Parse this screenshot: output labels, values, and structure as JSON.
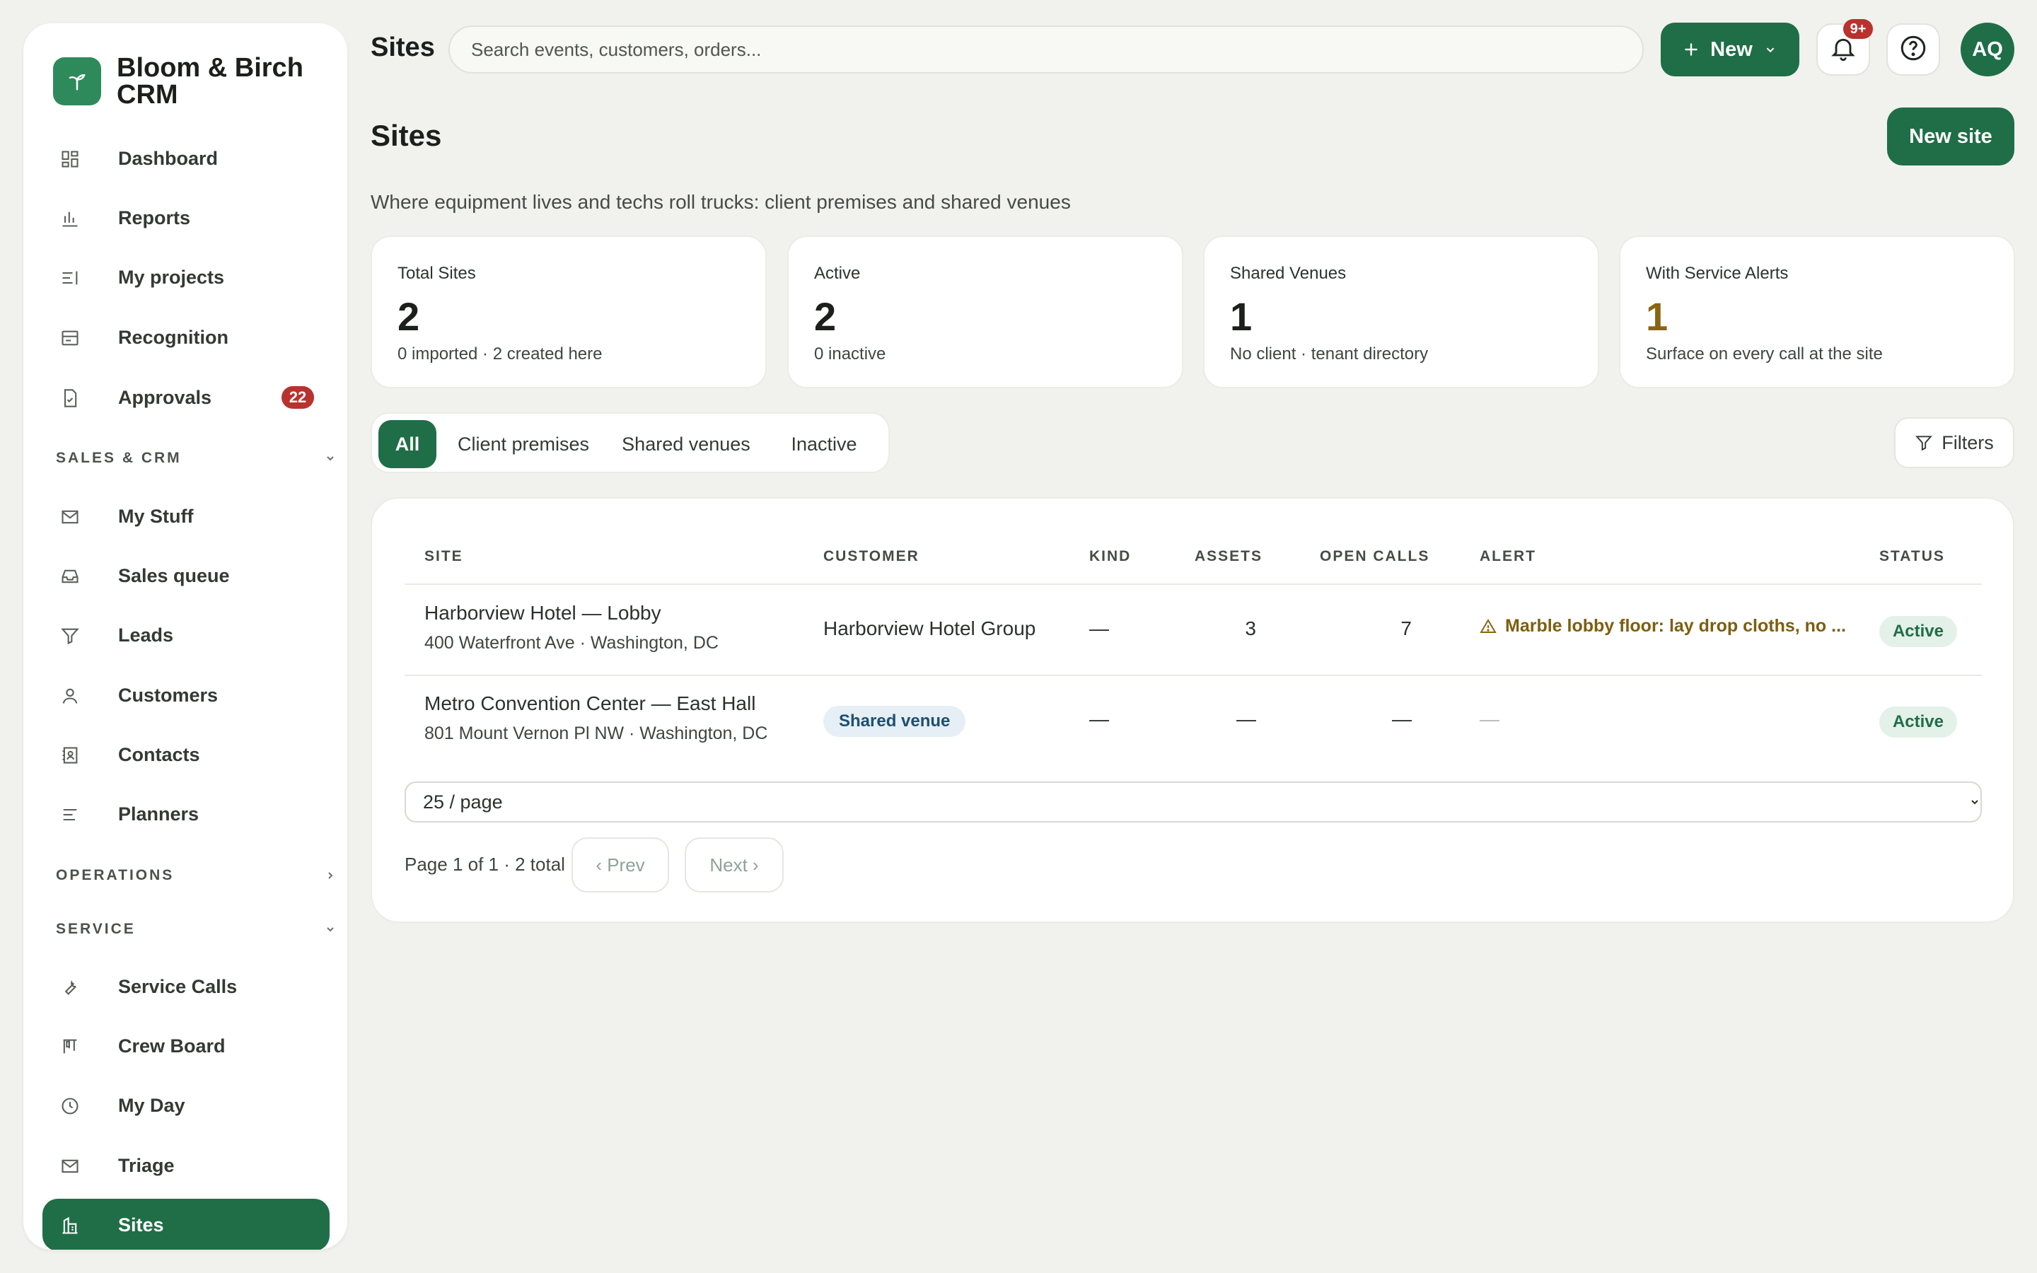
{
  "brand": {
    "name": "Bloom & Birch CRM",
    "logo_icon": "wand-icon",
    "color": "#2f8a5b"
  },
  "sidebar": {
    "items_top": [
      {
        "label": "Dashboard",
        "icon": "dashboard-icon"
      },
      {
        "label": "Reports",
        "icon": "bar-chart-icon"
      },
      {
        "label": "My projects",
        "icon": "list-icon"
      },
      {
        "label": "Recognition",
        "icon": "card-icon"
      },
      {
        "label": "Approvals",
        "icon": "document-icon",
        "badge": "22"
      }
    ],
    "sections": {
      "sales": {
        "label": "SALES & CRM",
        "expanded": true
      },
      "operations": {
        "label": "OPERATIONS",
        "expanded": false
      },
      "service": {
        "label": "SERVICE",
        "expanded": true
      }
    },
    "items_sales": [
      {
        "label": "My Stuff",
        "icon": "mail-icon"
      },
      {
        "label": "Sales queue",
        "icon": "inbox-icon"
      },
      {
        "label": "Leads",
        "icon": "funnel-icon"
      },
      {
        "label": "Customers",
        "icon": "user-icon"
      },
      {
        "label": "Contacts",
        "icon": "contact-book-icon"
      },
      {
        "label": "Planners",
        "icon": "lines-icon"
      }
    ],
    "items_service": [
      {
        "label": "Service Calls",
        "icon": "wrench-icon"
      },
      {
        "label": "Crew Board",
        "icon": "kanban-icon"
      },
      {
        "label": "My Day",
        "icon": "clock-icon"
      },
      {
        "label": "Triage",
        "icon": "mail-icon"
      },
      {
        "label": "Sites",
        "icon": "building-icon",
        "active": true
      }
    ],
    "active_color": "#1f6e47"
  },
  "topbar": {
    "title": "Sites",
    "search_placeholder": "Search events, customers, orders...",
    "new_label": "New",
    "notifications_badge": "9+",
    "avatar_initials": "AQ"
  },
  "page": {
    "title": "Sites",
    "new_site_label": "New site",
    "subtitle": "Where equipment lives and techs roll trucks: client premises and shared venues"
  },
  "stats": [
    {
      "label": "Total Sites",
      "value": "2",
      "note": "0 imported · 2 created here"
    },
    {
      "label": "Active",
      "value": "2",
      "note": "0 inactive"
    },
    {
      "label": "Shared Venues",
      "value": "1",
      "note": "No client · tenant directory"
    },
    {
      "label": "With Service Alerts",
      "value": "1",
      "note": "Surface on every call at the site",
      "accent": "#8a6511"
    }
  ],
  "tabs": [
    {
      "label": "All",
      "active": true
    },
    {
      "label": "Client premises"
    },
    {
      "label": "Shared venues"
    },
    {
      "label": "Inactive"
    }
  ],
  "filters_label": "Filters",
  "table": {
    "columns": [
      "SITE",
      "CUSTOMER",
      "KIND",
      "ASSETS",
      "OPEN CALLS",
      "ALERT",
      "STATUS"
    ],
    "rows": [
      {
        "site": "Harborview Hotel — Lobby",
        "address": "400 Waterfront Ave · Washington, DC",
        "customer": "Harborview Hotel Group",
        "kind": "—",
        "assets": "3",
        "open_calls": "7",
        "alert": "Marble lobby floor: lay drop cloths, no ...",
        "status": "Active"
      },
      {
        "site": "Metro Convention Center — East Hall",
        "address": "801 Mount Vernon Pl NW · Washington, DC",
        "customer_badge": "Shared venue",
        "kind": "—",
        "assets": "—",
        "open_calls": "—",
        "alert": "—",
        "status": "Active"
      }
    ]
  },
  "pagination": {
    "per_page": "25 / page",
    "info": "Page 1 of 1 · 2 total",
    "prev_label": "‹ Prev",
    "next_label": "Next ›"
  }
}
